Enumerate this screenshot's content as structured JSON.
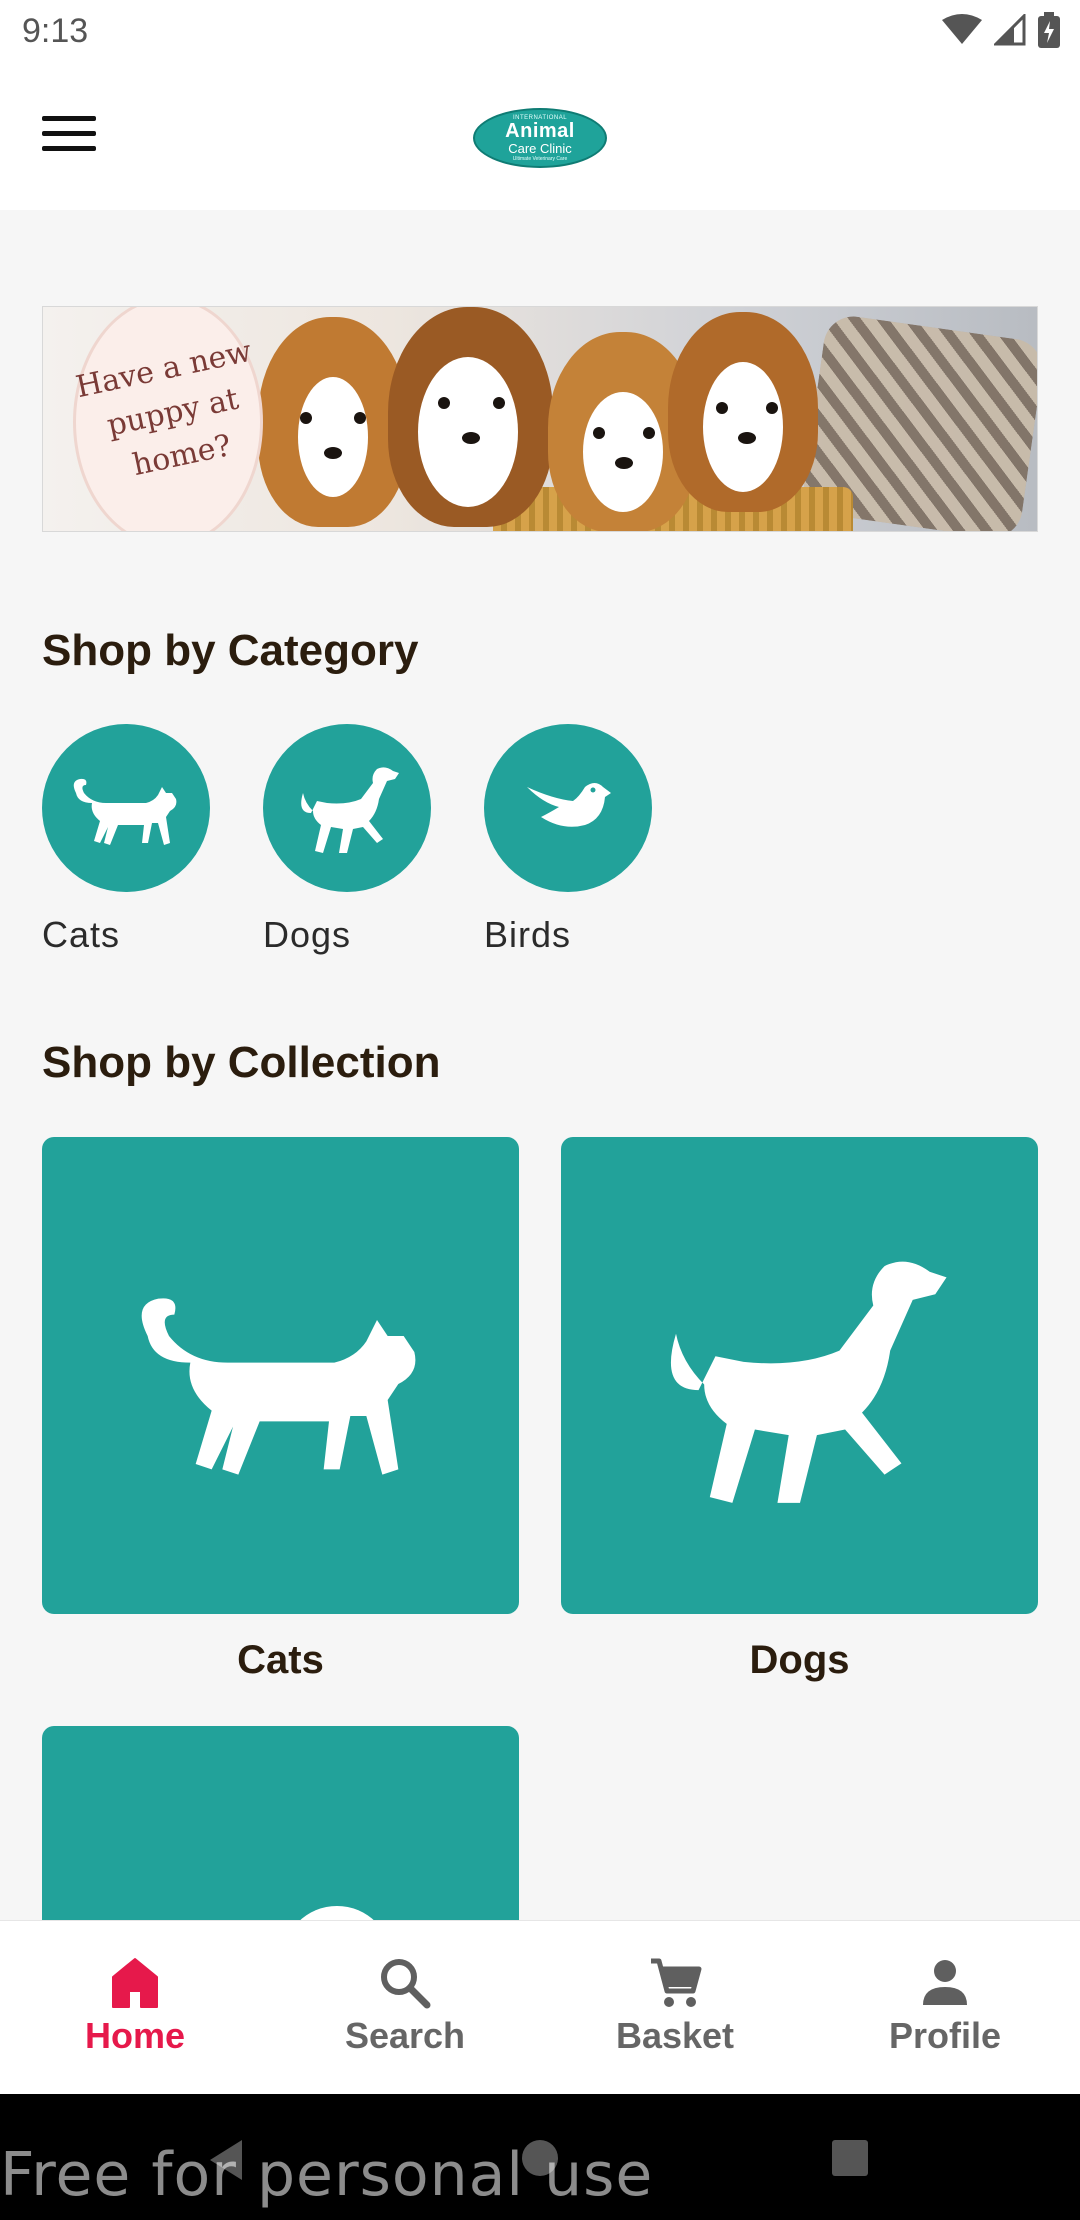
{
  "status_bar": {
    "time": "9:13"
  },
  "app_bar": {
    "logo": {
      "top": "INTERNATIONAL",
      "main": "Animal",
      "sub": "Care Clinic",
      "tag": "Ultimate Veterinary Care"
    }
  },
  "banner": {
    "text_line1": "Have a new",
    "text_line2": "puppy at",
    "text_line3": "home?"
  },
  "categories": {
    "title": "Shop by Category",
    "items": [
      {
        "label": "Cats",
        "icon": "cat-icon"
      },
      {
        "label": "Dogs",
        "icon": "dog-icon"
      },
      {
        "label": "Birds",
        "icon": "bird-icon"
      }
    ]
  },
  "collections": {
    "title": "Shop by Collection",
    "items": [
      {
        "label": "Cats",
        "icon": "cat-icon"
      },
      {
        "label": "Dogs",
        "icon": "dog-icon"
      }
    ]
  },
  "bottom_nav": {
    "items": [
      {
        "label": "Home",
        "icon": "home-icon",
        "active": true
      },
      {
        "label": "Search",
        "icon": "search-icon",
        "active": false
      },
      {
        "label": "Basket",
        "icon": "cart-icon",
        "active": false
      },
      {
        "label": "Profile",
        "icon": "person-icon",
        "active": false
      }
    ]
  },
  "watermark": "Free for personal use",
  "colors": {
    "accent": "#22a29a",
    "active_nav": "#e6194b",
    "title_text": "#2b1d0e"
  }
}
